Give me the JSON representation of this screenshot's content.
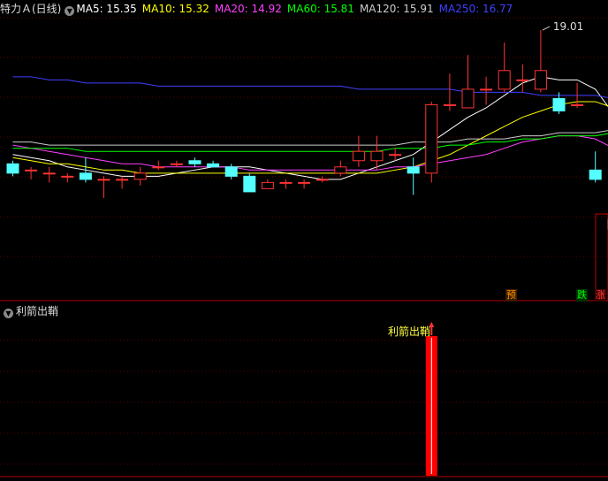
{
  "header": {
    "title": "特力Ａ(日线)",
    "ma": [
      {
        "label": "MA5:",
        "value": "15.35",
        "color": "#ffffff"
      },
      {
        "label": "MA10:",
        "value": "15.32",
        "color": "#ffff00"
      },
      {
        "label": "MA20:",
        "value": "14.92",
        "color": "#ff40ff"
      },
      {
        "label": "MA60:",
        "value": "15.81",
        "color": "#00ff00"
      },
      {
        "label": "MA120:",
        "value": "15.91",
        "color": "#cccccc"
      },
      {
        "label": "MA250:",
        "value": "16.77",
        "color": "#4040ff"
      }
    ]
  },
  "price_high_label": "19.01",
  "indicator": {
    "name": "利箭出鞘",
    "signal_label": "利箭出鞘"
  },
  "markers": {
    "yu": "预",
    "die": "跌",
    "zhang": "涨"
  },
  "chart_data": {
    "type": "candlestick",
    "ylim": [
      10.3,
      19.4
    ],
    "candles": [
      {
        "o": 14.7,
        "c": 14.4,
        "h": 14.8,
        "l": 14.3
      },
      {
        "o": 14.5,
        "c": 14.5,
        "h": 14.6,
        "l": 14.2
      },
      {
        "o": 14.4,
        "c": 14.4,
        "h": 14.6,
        "l": 14.1
      },
      {
        "o": 14.3,
        "c": 14.3,
        "h": 14.4,
        "l": 14.1
      },
      {
        "o": 14.4,
        "c": 14.2,
        "h": 14.9,
        "l": 14.1
      },
      {
        "o": 14.2,
        "c": 14.2,
        "h": 14.3,
        "l": 13.6
      },
      {
        "o": 14.2,
        "c": 14.2,
        "h": 14.3,
        "l": 13.9
      },
      {
        "o": 14.2,
        "c": 14.4,
        "h": 14.6,
        "l": 14.0
      },
      {
        "o": 14.6,
        "c": 14.6,
        "h": 14.8,
        "l": 14.5
      },
      {
        "o": 14.7,
        "c": 14.7,
        "h": 14.8,
        "l": 14.6
      },
      {
        "o": 14.8,
        "c": 14.7,
        "h": 14.9,
        "l": 14.6
      },
      {
        "o": 14.7,
        "c": 14.6,
        "h": 14.8,
        "l": 14.6
      },
      {
        "o": 14.6,
        "c": 14.3,
        "h": 14.7,
        "l": 14.2
      },
      {
        "o": 14.3,
        "c": 13.8,
        "h": 14.4,
        "l": 13.8
      },
      {
        "o": 13.9,
        "c": 14.1,
        "h": 14.2,
        "l": 13.9
      },
      {
        "o": 14.1,
        "c": 14.1,
        "h": 14.2,
        "l": 13.9
      },
      {
        "o": 14.1,
        "c": 14.1,
        "h": 14.2,
        "l": 13.9
      },
      {
        "o": 14.2,
        "c": 14.2,
        "h": 14.3,
        "l": 14.1
      },
      {
        "o": 14.4,
        "c": 14.6,
        "h": 14.8,
        "l": 14.3
      },
      {
        "o": 14.8,
        "c": 15.1,
        "h": 15.6,
        "l": 14.6
      },
      {
        "o": 14.8,
        "c": 15.1,
        "h": 15.6,
        "l": 14.5
      },
      {
        "o": 15.0,
        "c": 15.0,
        "h": 15.2,
        "l": 14.8
      },
      {
        "o": 14.6,
        "c": 14.4,
        "h": 14.9,
        "l": 13.7
      },
      {
        "o": 14.4,
        "c": 16.6,
        "h": 16.7,
        "l": 14.1
      },
      {
        "o": 16.6,
        "c": 16.6,
        "h": 17.6,
        "l": 16.4
      },
      {
        "o": 16.5,
        "c": 17.1,
        "h": 18.2,
        "l": 16.5
      },
      {
        "o": 17.1,
        "c": 17.1,
        "h": 17.5,
        "l": 16.6
      },
      {
        "o": 17.1,
        "c": 17.7,
        "h": 18.6,
        "l": 17.0
      },
      {
        "o": 17.4,
        "c": 17.4,
        "h": 17.9,
        "l": 17.0
      },
      {
        "o": 17.1,
        "c": 17.7,
        "h": 19.0,
        "l": 17.0
      },
      {
        "o": 16.8,
        "c": 16.4,
        "h": 17.0,
        "l": 16.3
      },
      {
        "o": 16.6,
        "c": 16.6,
        "h": 17.3,
        "l": 16.5
      },
      {
        "o": 14.5,
        "c": 14.2,
        "h": 15.1,
        "l": 14.1
      },
      {
        "o": 12.9,
        "c": 12.6,
        "h": 13.0,
        "l": 12.3
      },
      {
        "o": 12.3,
        "c": 11.3,
        "h": 12.4,
        "l": 11.3
      }
    ],
    "ma_series": [
      {
        "name": "MA5",
        "color": "#ffffff",
        "values": [
          15.0,
          14.9,
          14.8,
          14.6,
          14.5,
          14.4,
          14.3,
          14.3,
          14.3,
          14.4,
          14.5,
          14.6,
          14.6,
          14.6,
          14.5,
          14.4,
          14.3,
          14.2,
          14.2,
          14.4,
          14.6,
          14.8,
          15.0,
          15.4,
          15.8,
          16.2,
          16.5,
          16.9,
          17.3,
          17.5,
          17.4,
          17.4,
          17.1,
          16.3,
          15.35
        ]
      },
      {
        "name": "MA10",
        "color": "#ffff00",
        "values": [
          14.9,
          14.8,
          14.7,
          14.7,
          14.6,
          14.5,
          14.5,
          14.4,
          14.4,
          14.4,
          14.4,
          14.4,
          14.4,
          14.4,
          14.4,
          14.4,
          14.4,
          14.4,
          14.4,
          14.4,
          14.4,
          14.5,
          14.6,
          14.8,
          15.0,
          15.3,
          15.6,
          15.9,
          16.2,
          16.4,
          16.6,
          16.7,
          16.7,
          16.5,
          15.32
        ]
      },
      {
        "name": "MA20",
        "color": "#ff40ff",
        "values": [
          15.3,
          15.2,
          15.1,
          15.0,
          14.9,
          14.8,
          14.7,
          14.7,
          14.6,
          14.6,
          14.6,
          14.6,
          14.6,
          14.5,
          14.5,
          14.5,
          14.5,
          14.5,
          14.5,
          14.5,
          14.5,
          14.6,
          14.6,
          14.7,
          14.8,
          14.9,
          15.0,
          15.2,
          15.4,
          15.5,
          15.6,
          15.6,
          15.5,
          15.2,
          14.92
        ]
      },
      {
        "name": "MA60",
        "color": "#00ff00",
        "values": [
          15.2,
          15.2,
          15.2,
          15.2,
          15.1,
          15.1,
          15.1,
          15.1,
          15.1,
          15.1,
          15.1,
          15.1,
          15.1,
          15.1,
          15.1,
          15.1,
          15.1,
          15.1,
          15.1,
          15.1,
          15.1,
          15.2,
          15.2,
          15.2,
          15.3,
          15.3,
          15.4,
          15.4,
          15.5,
          15.5,
          15.6,
          15.6,
          15.6,
          15.7,
          15.81
        ]
      },
      {
        "name": "MA120",
        "color": "#cccccc",
        "values": [
          15.4,
          15.4,
          15.3,
          15.3,
          15.3,
          15.3,
          15.3,
          15.3,
          15.3,
          15.3,
          15.3,
          15.3,
          15.3,
          15.3,
          15.3,
          15.3,
          15.3,
          15.3,
          15.3,
          15.3,
          15.3,
          15.3,
          15.4,
          15.4,
          15.4,
          15.5,
          15.5,
          15.5,
          15.6,
          15.6,
          15.7,
          15.7,
          15.7,
          15.8,
          15.91
        ]
      },
      {
        "name": "MA250",
        "color": "#4040ff",
        "values": [
          17.5,
          17.5,
          17.4,
          17.4,
          17.3,
          17.3,
          17.3,
          17.3,
          17.2,
          17.2,
          17.2,
          17.2,
          17.2,
          17.2,
          17.2,
          17.2,
          17.2,
          17.2,
          17.2,
          17.1,
          17.1,
          17.1,
          17.1,
          17.1,
          17.1,
          17.0,
          17.0,
          17.0,
          17.0,
          16.9,
          16.9,
          16.9,
          16.9,
          16.8,
          16.77
        ]
      }
    ],
    "signal_index": 23
  }
}
